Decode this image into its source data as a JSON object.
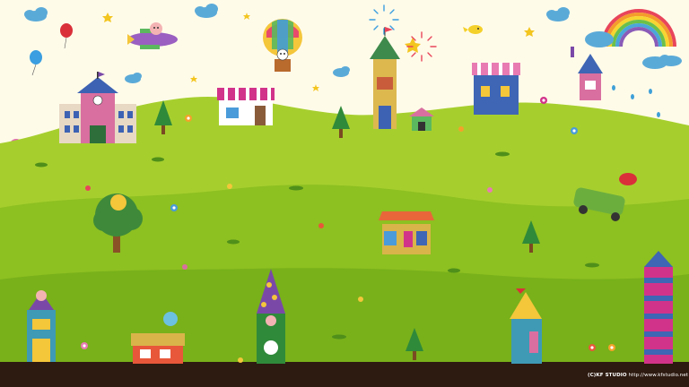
{
  "scene": {
    "description_tag": "illustrated-village-wallpaper"
  },
  "credit": {
    "studio": "(C)KF STUDIO",
    "url": "http://www.kfstudio.net"
  },
  "colors": {
    "sky": "#fffbe9",
    "hill_back": "#a6cf2e",
    "hill_mid": "#8dc021",
    "hill_front": "#78b11a",
    "ground": "#2d1a10",
    "rainbow": [
      "#e8455a",
      "#f49b2c",
      "#f7d531",
      "#6cc04a",
      "#4aa7d9",
      "#8a5bb8"
    ]
  }
}
